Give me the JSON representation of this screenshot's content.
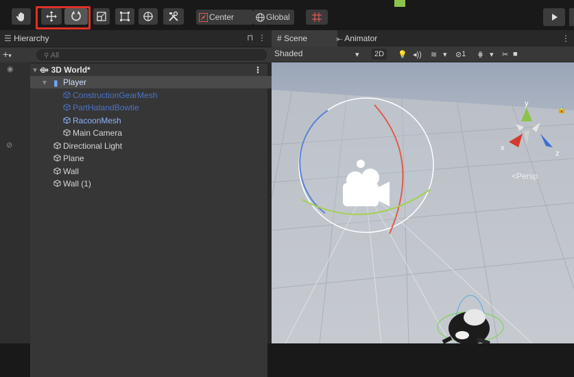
{
  "toolbar": {
    "center_label": "Center",
    "global_label": "Global",
    "tools": [
      "hand-tool",
      "move-tool",
      "rotate-tool",
      "scale-tool",
      "rect-tool",
      "transform-tool",
      "custom-tool"
    ]
  },
  "hierarchy": {
    "tab_label": "Hierarchy",
    "search_placeholder": "All",
    "scene_name": "3D World*",
    "items": [
      {
        "label": "Player",
        "depth": 1,
        "color": "#cfe0ff",
        "selected": true
      },
      {
        "label": "ConstructionGearMesh",
        "depth": 2,
        "color": "#4b73c8"
      },
      {
        "label": "PartHatandBowtie",
        "depth": 2,
        "color": "#4b73c8"
      },
      {
        "label": "RacoonMesh",
        "depth": 2,
        "color": "#8fb3ff"
      },
      {
        "label": "Main Camera",
        "depth": 2,
        "color": "#d6d6d6"
      },
      {
        "label": "Directional Light",
        "depth": 1,
        "color": "#d6d6d6"
      },
      {
        "label": "Plane",
        "depth": 1,
        "color": "#d6d6d6"
      },
      {
        "label": "Wall",
        "depth": 1,
        "color": "#d6d6d6"
      },
      {
        "label": "Wall (1)",
        "depth": 1,
        "color": "#d6d6d6"
      }
    ]
  },
  "scene_view": {
    "tabs": [
      "Scene",
      "Animator"
    ],
    "shading": "Shaded",
    "mode_2d": "2D",
    "hidden_count": "1",
    "persp_label": "<Persp",
    "gizmo": {
      "x": "x",
      "y": "y",
      "z": "z"
    }
  }
}
